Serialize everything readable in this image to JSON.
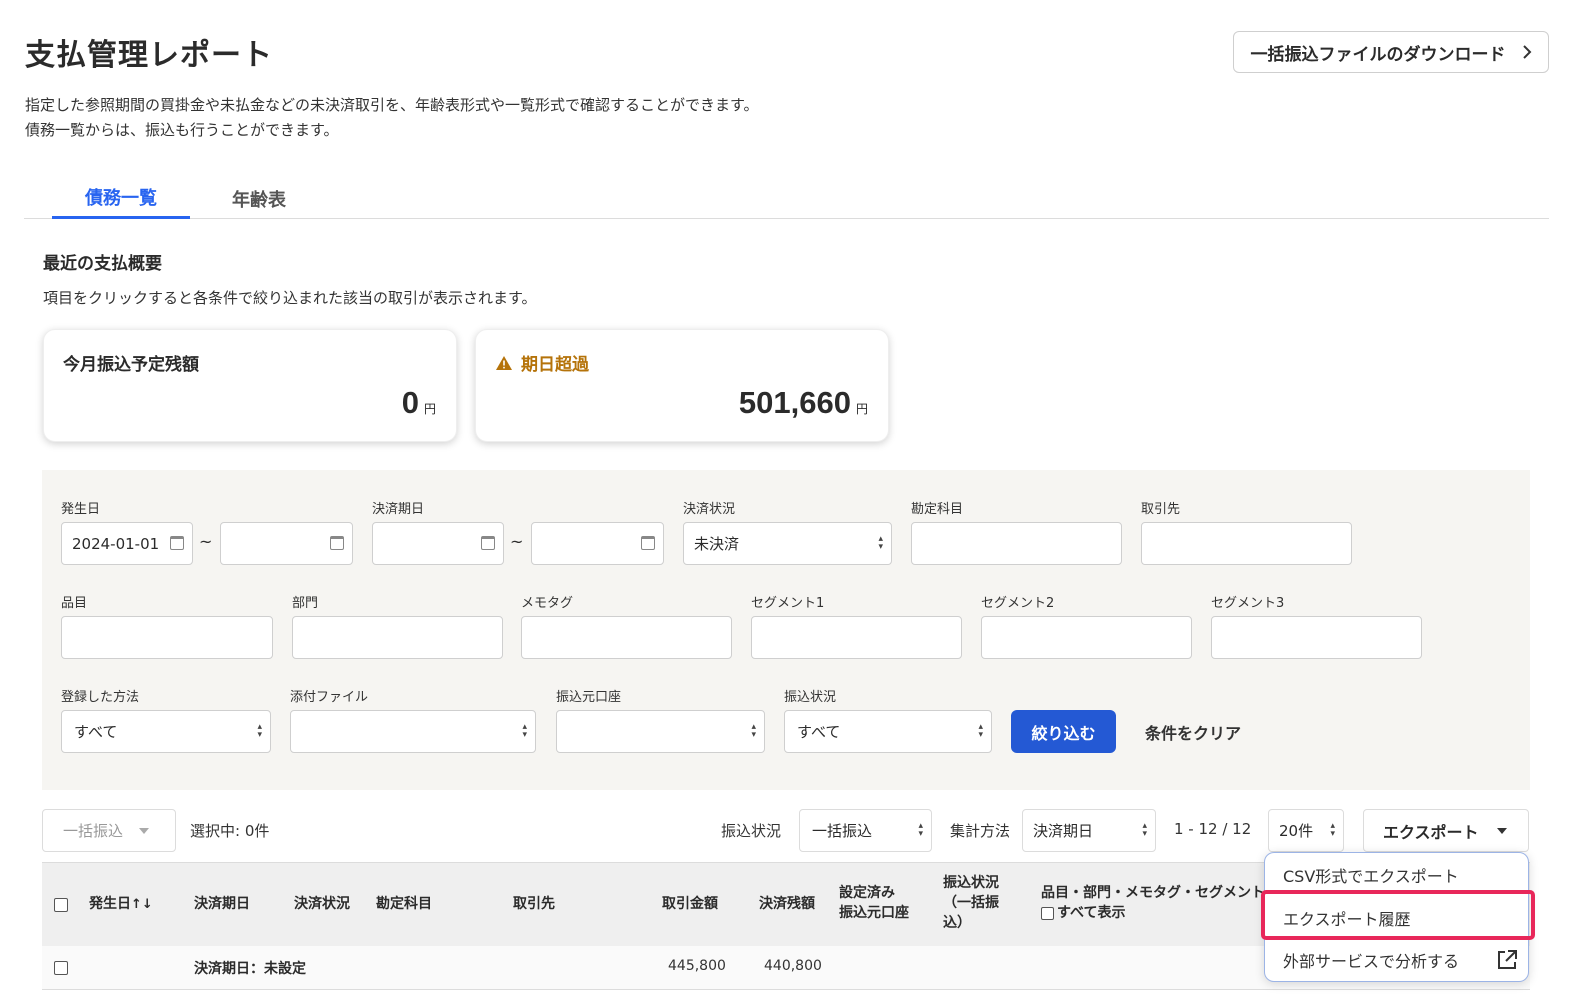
{
  "header": {
    "title": "支払管理レポート",
    "download_button": "一括振込ファイルのダウンロード",
    "description_line1": "指定した参照期間の買掛金や未払金などの未決済取引を、年齢表形式や一覧形式で確認することができます。",
    "description_line2": "債務一覧からは、振込も行うことができます。"
  },
  "tabs": [
    {
      "label": "債務一覧",
      "active": true
    },
    {
      "label": "年齢表",
      "active": false
    }
  ],
  "summary": {
    "title": "最近の支払概要",
    "hint": "項目をクリックすると各条件で絞り込まれた該当の取引が表示されます。",
    "cards": [
      {
        "title": "今月振込予定残額",
        "value": "0",
        "unit": "円"
      },
      {
        "title": "期日超過",
        "value": "501,660",
        "unit": "円",
        "icon": "warning-icon"
      }
    ]
  },
  "filters": {
    "issue_date_label": "発生日",
    "issue_date_from": "2024-01-01",
    "issue_date_to": "",
    "due_date_label": "決済期日",
    "due_date_from": "",
    "due_date_to": "",
    "range_sep": "~",
    "status_label": "決済状況",
    "status_value": "未決済",
    "account_label": "勘定科目",
    "partner_label": "取引先",
    "item_label": "品目",
    "section_label": "部門",
    "memo_tag_label": "メモタグ",
    "segment1_label": "セグメント1",
    "segment2_label": "セグメント2",
    "segment3_label": "セグメント3",
    "method_label": "登録した方法",
    "method_value": "すべて",
    "attachment_label": "添付ファイル",
    "attachment_value": "",
    "source_account_label": "振込元口座",
    "source_account_value": "",
    "transfer_status_label": "振込状況",
    "transfer_status_value": "すべて",
    "apply_button": "絞り込む",
    "clear_button": "条件をクリア"
  },
  "toolbar": {
    "bulk_transfer_button": "一括振込",
    "selected_count": "選択中: 0件",
    "transfer_status_label": "振込状況",
    "transfer_status_value": "一括振込",
    "aggregation_label": "集計方法",
    "aggregation_value": "決済期日",
    "pagination": "1 - 12 / 12",
    "per_page": "20件",
    "export_button": "エクスポート"
  },
  "table": {
    "headers": {
      "issue_date": "発生日",
      "due_date": "決済期日",
      "status": "決済状況",
      "account": "勘定科目",
      "partner": "取引先",
      "amount": "取引金額",
      "balance": "決済残額",
      "source_account_l1": "設定済み",
      "source_account_l2": "振込元口座",
      "transfer_status_l1": "振込状況",
      "transfer_status_l2": "（一括振",
      "transfer_status_l3": "込）",
      "tags": "品目・部門・メモタグ・セグメント",
      "show_all": "すべて表示"
    },
    "group_row": {
      "label": "決済期日：未設定",
      "amount": "445,800",
      "balance": "440,800"
    }
  },
  "export_menu": {
    "items": [
      {
        "label": "CSV形式でエクスポート"
      },
      {
        "label": "エクスポート履歴",
        "highlighted": true
      },
      {
        "label": "外部サービスで分析する",
        "icon": "external-link-icon"
      }
    ]
  },
  "colors": {
    "primary": "#2459d4",
    "tab_active": "#2864f0",
    "warning": "#b5730a",
    "highlight": "#e8275a"
  }
}
